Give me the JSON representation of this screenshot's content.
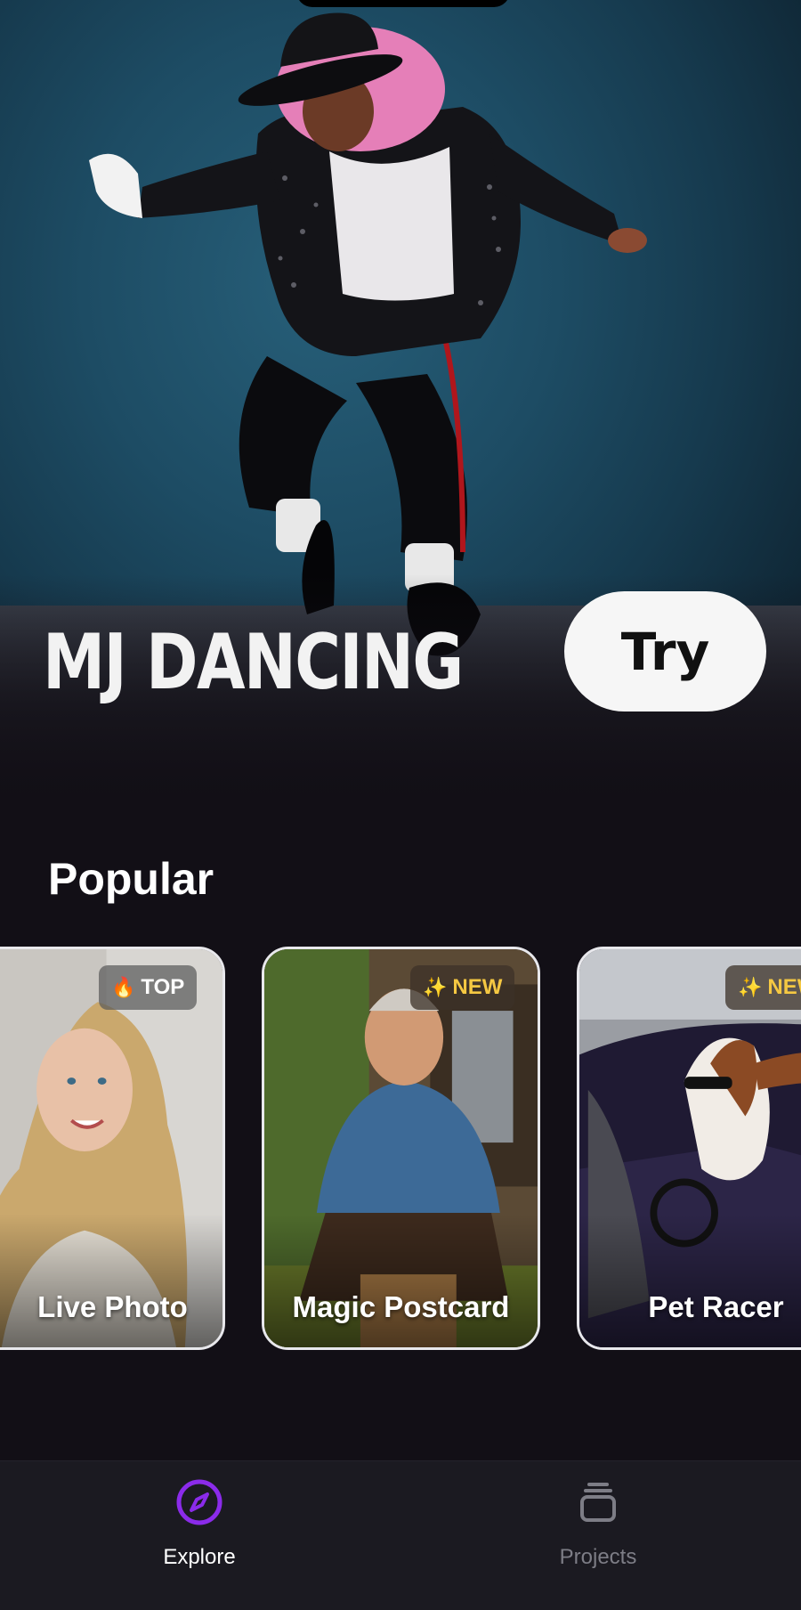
{
  "hero": {
    "title": "MJ DANCING",
    "try_label": "Try"
  },
  "popular": {
    "title": "Popular",
    "cards": [
      {
        "label": "Live Photo",
        "badge": {
          "text": "TOP",
          "icon": "fire-icon",
          "glyph": "🔥"
        }
      },
      {
        "label": "Magic Postcard",
        "badge": {
          "text": "NEW",
          "icon": "sparkles-icon",
          "glyph": "✨"
        }
      },
      {
        "label": "Pet Racer",
        "badge": {
          "text": "NEW",
          "icon": "sparkles-icon",
          "glyph": "✨"
        }
      }
    ]
  },
  "tabbar": {
    "tabs": [
      {
        "label": "Explore",
        "icon": "compass-icon",
        "active": true
      },
      {
        "label": "Projects",
        "icon": "stack-icon",
        "active": false
      }
    ]
  },
  "colors": {
    "background": "#120f16",
    "accent": "#8b2bea",
    "badge_new": "#f5c842",
    "tab_inactive": "#7d7d86"
  }
}
